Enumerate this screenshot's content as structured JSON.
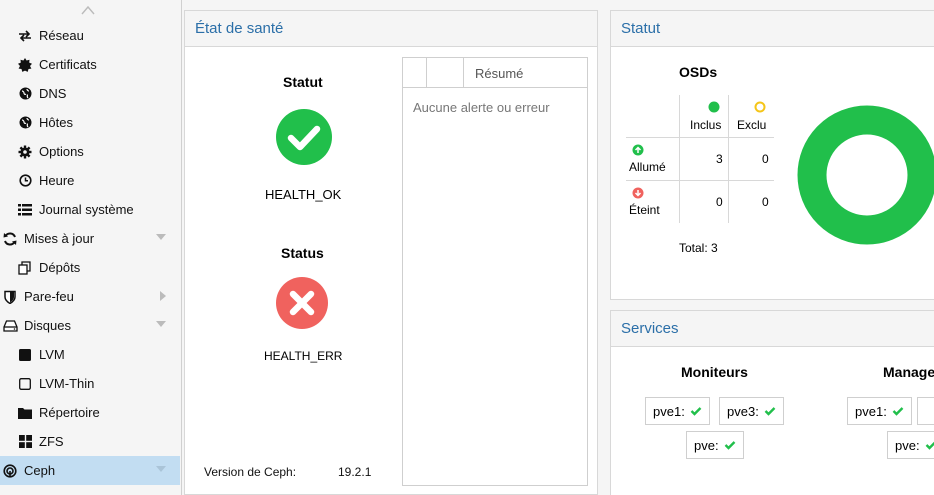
{
  "sidebar": {
    "items": [
      {
        "label": "Réseau",
        "icon": "network-icon"
      },
      {
        "label": "Certificats",
        "icon": "certificate-icon"
      },
      {
        "label": "DNS",
        "icon": "globe-icon"
      },
      {
        "label": "Hôtes",
        "icon": "globe-icon"
      },
      {
        "label": "Options",
        "icon": "gear-icon"
      },
      {
        "label": "Heure",
        "icon": "clock-icon"
      },
      {
        "label": "Journal système",
        "icon": "list-icon"
      },
      {
        "label": "Mises à jour",
        "icon": "refresh-icon"
      },
      {
        "label": "Dépôts",
        "icon": "copy-icon"
      },
      {
        "label": "Pare-feu",
        "icon": "shield-icon"
      },
      {
        "label": "Disques",
        "icon": "drive-icon"
      },
      {
        "label": "LVM",
        "icon": "square-icon"
      },
      {
        "label": "LVM-Thin",
        "icon": "square-outline-icon"
      },
      {
        "label": "Répertoire",
        "icon": "folder-icon"
      },
      {
        "label": "ZFS",
        "icon": "grid-icon"
      },
      {
        "label": "Ceph",
        "icon": "ceph-icon"
      }
    ]
  },
  "health": {
    "header": "État de santé",
    "statut_title": "Statut",
    "statut_value": "HEALTH_OK",
    "status_title": "Status",
    "status_value": "HEALTH_ERR",
    "summary_header": "Résumé",
    "summary_empty": "Aucune alerte ou erreur",
    "version_label": "Version de Ceph:",
    "version_value": "19.2.1"
  },
  "statut": {
    "header": "Statut",
    "osds_title": "OSDs",
    "col_in": "Inclus",
    "col_out": "Exclu",
    "row_up": "Allumé",
    "row_down": "Éteint",
    "up_in": "3",
    "up_out": "0",
    "down_in": "0",
    "down_out": "0",
    "total": "Total: 3",
    "colors": {
      "in": "#21bf4b",
      "out": "#f5c518",
      "up": "#21bf4b",
      "down": "#f0625e"
    }
  },
  "services": {
    "header": "Services",
    "monitors_title": "Moniteurs",
    "managers_title": "Manage",
    "monitors": [
      "pve1:",
      "pve3:",
      "pve:"
    ],
    "managers": [
      "pve1:",
      "pve:"
    ]
  },
  "colors": {
    "ok": "#21bf4b",
    "err": "#f0625e",
    "accent": "#2b6fa8"
  }
}
